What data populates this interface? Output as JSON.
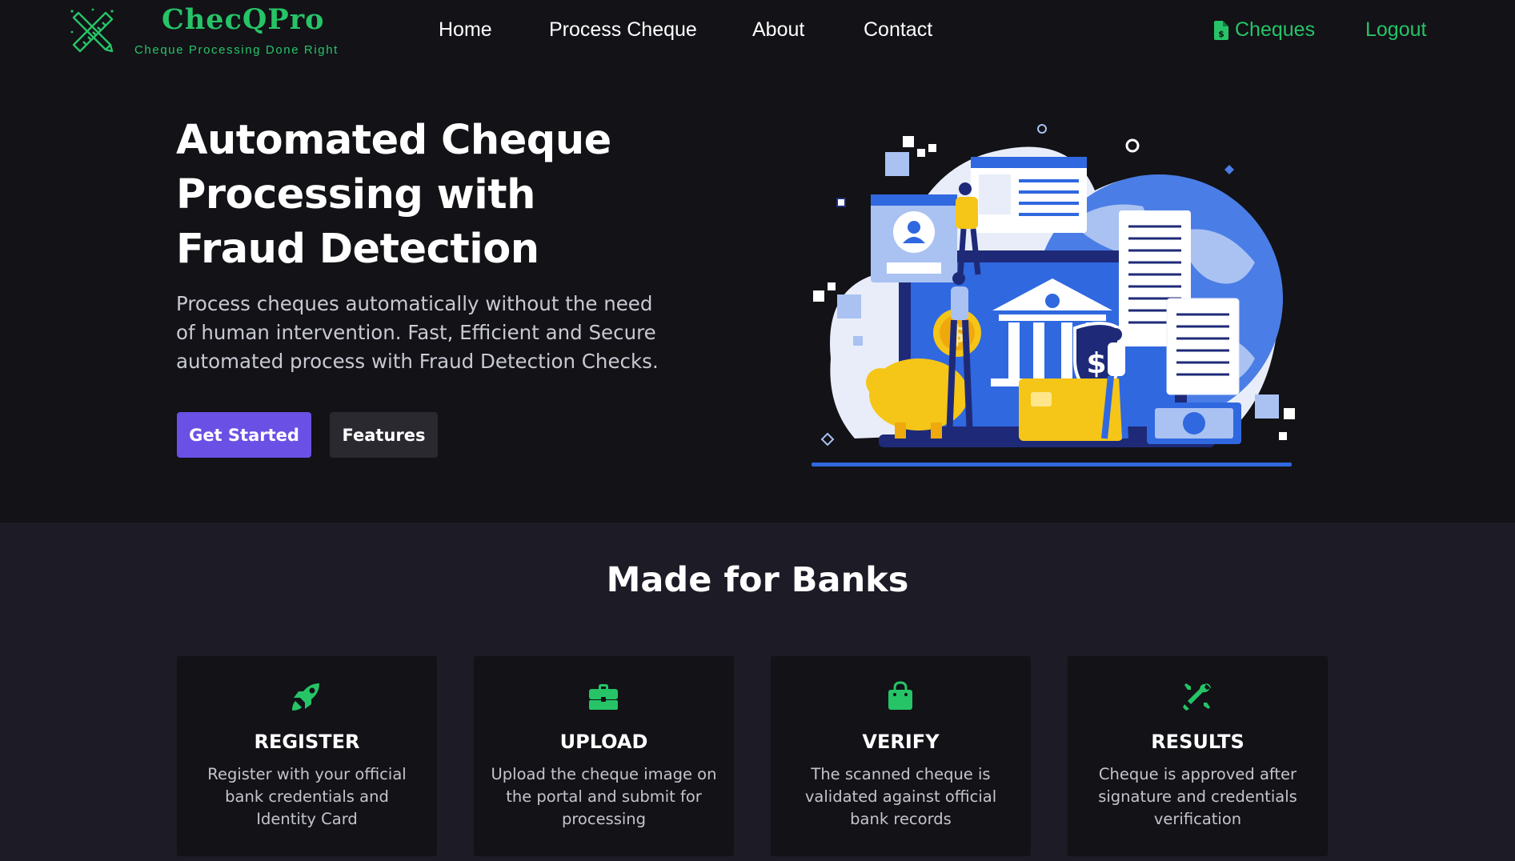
{
  "brand": {
    "name": "ChecQPro",
    "tagline": "Cheque Processing Done Right",
    "color": "#26c467"
  },
  "nav": {
    "links": [
      "Home",
      "Process Cheque",
      "About",
      "Contact"
    ],
    "cheques_label": "Cheques",
    "cheques_icon": "file-invoice-dollar-icon",
    "logout_label": "Logout"
  },
  "hero": {
    "title": "Automated Cheque Processing with Fraud Detection",
    "description": "Process cheques automatically without the need of human intervention. Fast, Efficient and Secure automated process with Fraud Detection Checks.",
    "primary_button": "Get Started",
    "secondary_button": "Features",
    "primary_color": "#6b50e6"
  },
  "features": {
    "title": "Made for Banks",
    "cards": [
      {
        "icon": "rocket-icon",
        "title": "REGISTER",
        "text": "Register with your official bank credentials and Identity Card"
      },
      {
        "icon": "briefcase-icon",
        "title": "UPLOAD",
        "text": "Upload the cheque image on the portal and submit for processing"
      },
      {
        "icon": "shopping-bag-icon",
        "title": "VERIFY",
        "text": "The scanned cheque is validated against official bank records"
      },
      {
        "icon": "tools-icon",
        "title": "RESULTS",
        "text": "Cheque is approved after signature and credentials verification"
      }
    ]
  }
}
